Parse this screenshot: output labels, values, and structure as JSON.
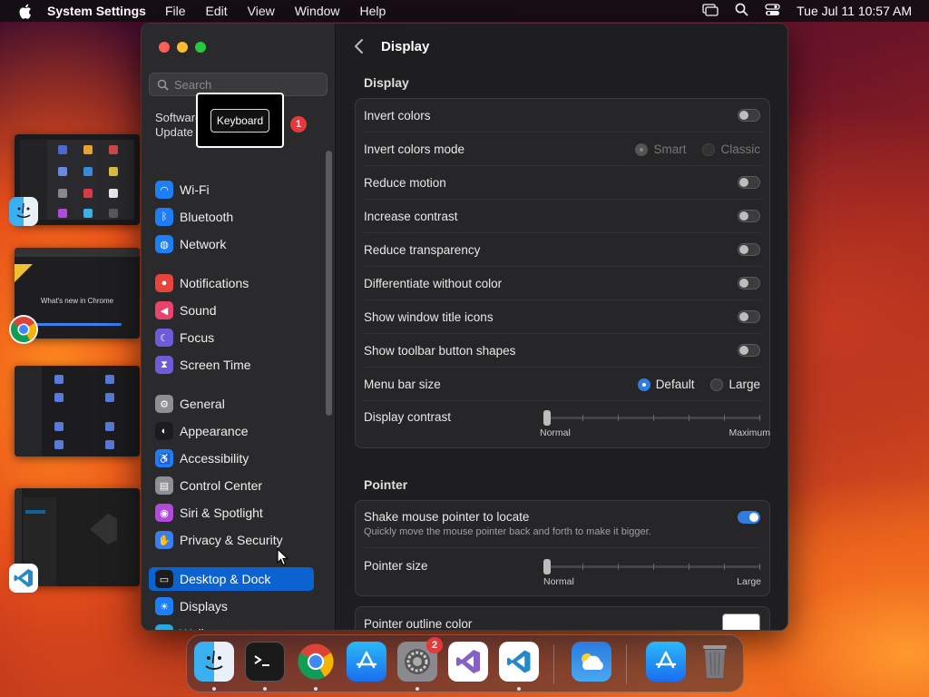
{
  "menubar": {
    "app": "System Settings",
    "items": [
      "File",
      "Edit",
      "View",
      "Window",
      "Help"
    ],
    "clock": "Tue Jul 11  10:57 AM"
  },
  "window": {
    "title": "Display"
  },
  "sidebar": {
    "search_placeholder": "Search",
    "software_update": "Software Update Available",
    "software_update_badge": "1",
    "tooltip": "Keyboard",
    "items": [
      {
        "label": "Wi-Fi",
        "icon": "wifi-icon",
        "color": "#1e7ef5"
      },
      {
        "label": "Bluetooth",
        "icon": "bluetooth-icon",
        "color": "#1e7ef5"
      },
      {
        "label": "Network",
        "icon": "globe-icon",
        "color": "#1e7ef5"
      },
      {
        "label": "Notifications",
        "icon": "bell-icon",
        "color": "#e8443b"
      },
      {
        "label": "Sound",
        "icon": "speaker-icon",
        "color": "#e8446b"
      },
      {
        "label": "Focus",
        "icon": "moon-icon",
        "color": "#6d5bd8"
      },
      {
        "label": "Screen Time",
        "icon": "hourglass-icon",
        "color": "#6d5bd8"
      },
      {
        "label": "General",
        "icon": "gear-icon",
        "color": "#8e8e93"
      },
      {
        "label": "Appearance",
        "icon": "appearance-icon",
        "color": "#1c1c1e"
      },
      {
        "label": "Accessibility",
        "icon": "accessibility-icon",
        "color": "#1e7ef5"
      },
      {
        "label": "Control Center",
        "icon": "control-center-icon",
        "color": "#8e8e93"
      },
      {
        "label": "Siri & Spotlight",
        "icon": "siri-icon",
        "color": "#b04ad8"
      },
      {
        "label": "Privacy & Security",
        "icon": "hand-icon",
        "color": "#3a7ef0"
      },
      {
        "label": "Desktop & Dock",
        "icon": "desktop-icon",
        "color": "#1c1c1e",
        "selected": true
      },
      {
        "label": "Displays",
        "icon": "sun-icon",
        "color": "#1e7ef5"
      },
      {
        "label": "Wallpaper",
        "icon": "wallpaper-icon",
        "color": "#2aa8e0"
      }
    ]
  },
  "display": {
    "section": "Display",
    "rows": [
      {
        "label": "Invert colors",
        "type": "toggle",
        "on": false
      },
      {
        "label": "Invert colors mode",
        "type": "radio",
        "options": [
          "Smart",
          "Classic"
        ],
        "selected": "Smart",
        "disabled": true
      },
      {
        "label": "Reduce motion",
        "type": "toggle",
        "on": false
      },
      {
        "label": "Increase contrast",
        "type": "toggle",
        "on": false
      },
      {
        "label": "Reduce transparency",
        "type": "toggle",
        "on": false
      },
      {
        "label": "Differentiate without color",
        "type": "toggle",
        "on": false
      },
      {
        "label": "Show window title icons",
        "type": "toggle",
        "on": false
      },
      {
        "label": "Show toolbar button shapes",
        "type": "toggle",
        "on": false
      },
      {
        "label": "Menu bar size",
        "type": "radio",
        "options": [
          "Default",
          "Large"
        ],
        "selected": "Default",
        "disabled": false
      },
      {
        "label": "Display contrast",
        "type": "slider",
        "min_label": "Normal",
        "max_label": "Maximum",
        "value": 0
      }
    ]
  },
  "pointer": {
    "section": "Pointer",
    "shake_label": "Shake mouse pointer to locate",
    "shake_sub": "Quickly move the mouse pointer back and forth to make it bigger.",
    "shake_on": true,
    "size_label": "Pointer size",
    "size_min": "Normal",
    "size_max": "Large",
    "size_value": 0,
    "outline_label": "Pointer outline color",
    "outline_color": "#ffffff"
  },
  "dock": {
    "apps": [
      "finder-icon",
      "terminal-icon",
      "chrome-icon",
      "app-store-icon",
      "system-settings-icon",
      "visual-studio-icon",
      "vscode-icon",
      "weather-icon",
      "app-store-download-icon",
      "trash-icon"
    ],
    "settings_badge": "2"
  },
  "stage": {
    "apps": [
      "finder-icon",
      "chrome-icon",
      "vscode-icon"
    ],
    "chrome_thumb_text": "What's new in Chrome"
  }
}
